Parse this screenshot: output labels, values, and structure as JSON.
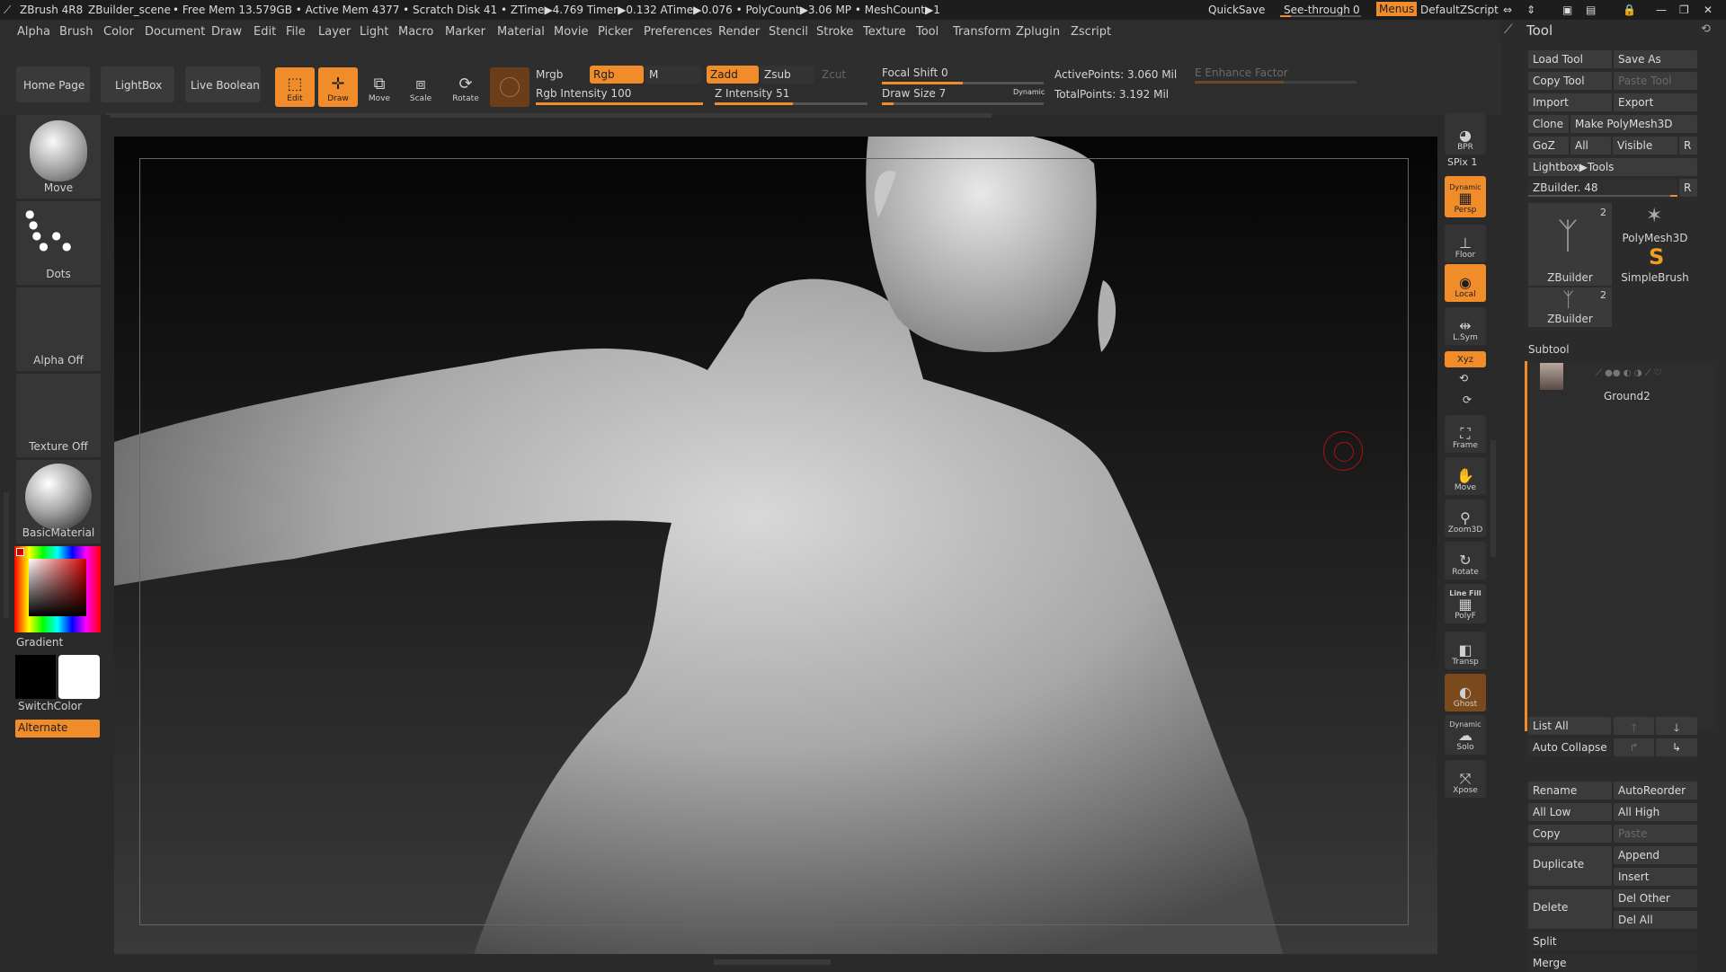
{
  "titlebar": {
    "app": "ZBrush 4R8",
    "scene": "ZBuilder_scene",
    "stats": "• Free Mem 13.579GB • Active Mem 4377 • Scratch Disk 41 •  ZTime▶4.769 Timer▶0.132 ATime▶0.076 • PolyCount▶3.06 MP  • MeshCount▶1",
    "quicksave": "QuickSave",
    "seethrough_label": "See-through",
    "seethrough_value": "0",
    "menus": "Menus",
    "script": "DefaultZScript"
  },
  "menubar": [
    "Alpha",
    "Brush",
    "Color",
    "Document",
    "Draw",
    "Edit",
    "File",
    "Layer",
    "Light",
    "Macro",
    "Marker",
    "Material",
    "Movie",
    "Picker",
    "Preferences",
    "Render",
    "Stencil",
    "Stroke",
    "Texture",
    "Tool",
    "Transform",
    "Zplugin",
    "Zscript"
  ],
  "shelf": {
    "home": "Home Page",
    "lightbox": "LightBox",
    "live_boolean": "Live Boolean",
    "edit": "Edit",
    "draw": "Draw",
    "move": "Move",
    "scale": "Scale",
    "rotate": "Rotate",
    "mrgb": "Mrgb",
    "rgb": "Rgb",
    "m": "M",
    "zadd": "Zadd",
    "zsub": "Zsub",
    "zcut": "Zcut",
    "rgb_intensity": "Rgb Intensity 100",
    "z_intensity": "Z Intensity 51",
    "focal_shift": "Focal Shift 0",
    "draw_size": "Draw Size 7",
    "dynamic": "Dynamic",
    "active_points": "ActivePoints: 3.060 Mil",
    "total_points": "TotalPoints: 3.192 Mil",
    "enhance": "E Enhance Factor",
    "levels": {
      "rgb_intensity": 1.0,
      "z_intensity": 0.51,
      "focal_shift": 0.5,
      "draw_size": 0.07,
      "enhance": 0.55
    }
  },
  "left": {
    "brush": "Move",
    "stroke": "Dots",
    "alpha": "Alpha Off",
    "texture": "Texture Off",
    "material": "BasicMaterial",
    "gradient": "Gradient",
    "switchcolor": "SwitchColor",
    "alternate": "Alternate"
  },
  "rightstrip": {
    "bpr": "BPR",
    "spix": "SPix 1",
    "persp": "Persp",
    "dynamic": "Dynamic",
    "floor": "Floor",
    "local": "Local",
    "lsym": "L.Sym",
    "xyz": "Xyz",
    "frame": "Frame",
    "move": "Move",
    "zoom3d": "Zoom3D",
    "rotate": "Rotate",
    "linefill": "Line Fill",
    "polyf": "PolyF",
    "transp": "Transp",
    "ghost": "Ghost",
    "dynamic2": "Dynamic",
    "solo": "Solo",
    "xpose": "Xpose"
  },
  "toolpanel": {
    "title": "Tool",
    "load": "Load Tool",
    "saveas": "Save As",
    "copy": "Copy Tool",
    "paste": "Paste Tool",
    "import": "Import",
    "export": "Export",
    "clone": "Clone",
    "makepoly": "Make PolyMesh3D",
    "goz": "GoZ",
    "all": "All",
    "visible": "Visible",
    "r": "R",
    "lightbox_tools": "Lightbox▶Tools",
    "zbuilder_value": "ZBuilder. 48",
    "thumb1_name": "ZBuilder",
    "thumb1_count": "2",
    "polymesh": "PolyMesh3D",
    "simplebrush": "SimpleBrush",
    "thumb2_name": "ZBuilder",
    "thumb2_count": "2",
    "subtool": "Subtool",
    "ground": "Ground2",
    "listall": "List All",
    "autocollapse": "Auto Collapse",
    "rename": "Rename",
    "autoreorder": "AutoReorder",
    "alllow": "All Low",
    "allhigh": "All High",
    "copy2": "Copy",
    "paste2": "Paste",
    "duplicate": "Duplicate",
    "append": "Append",
    "insert": "Insert",
    "delete": "Delete",
    "delother": "Del Other",
    "delall": "Del All",
    "split": "Split",
    "merge": "Merge"
  },
  "colors": {
    "accent": "#f08c2a",
    "bg": "#2a2a2a",
    "panel": "#3a3a3a"
  }
}
